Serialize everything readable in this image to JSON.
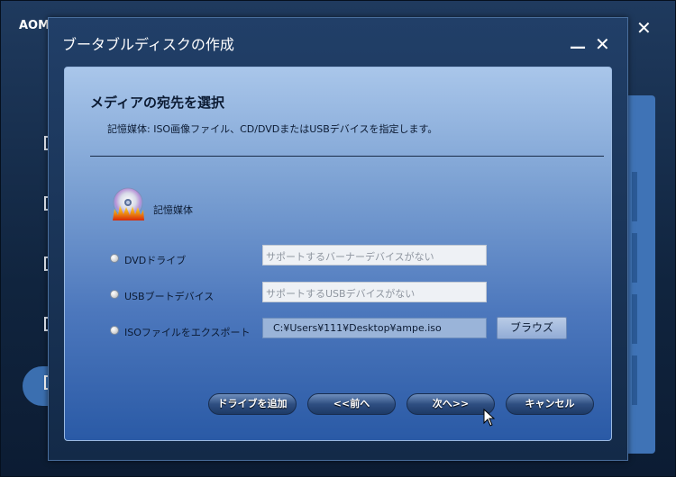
{
  "background_app": {
    "title": "AOM",
    "close_glyph": "✕"
  },
  "dialog": {
    "title": "ブータブルディスクの作成",
    "minimize_glyph": "—",
    "close_glyph": "✕",
    "heading": "メディアの宛先を選択",
    "subtext": "記憶媒体: ISO画像ファイル、CD/DVDまたはUSBデバイスを指定します。",
    "media_label": "記憶媒体",
    "media_icon": "disc-icon",
    "options": [
      {
        "label": "DVDドライブ",
        "field_text": "サポートするバーナーデバイスがない",
        "field_kind": "placeholder"
      },
      {
        "label": "USBブートデバイス",
        "field_text": "サポートするUSBデバイスがない",
        "field_kind": "placeholder"
      },
      {
        "label": "ISOファイルをエクスポート",
        "field_text": "C:¥Users¥111¥Desktop¥ampe.iso",
        "field_kind": "value"
      }
    ],
    "browse_label": "ブラウズ",
    "buttons": {
      "add_drive": "ドライブを追加",
      "back": "<<前へ",
      "next": "次へ>>",
      "cancel": "キャンセル"
    }
  }
}
